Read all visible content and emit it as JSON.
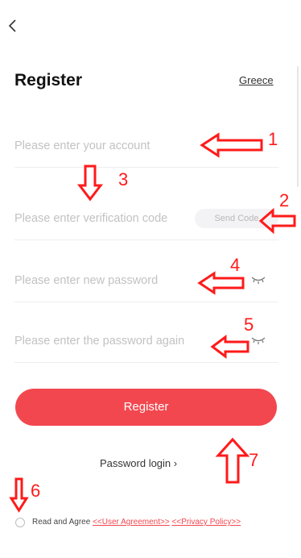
{
  "header": {
    "back_icon": "chevron-left-icon"
  },
  "title": "Register",
  "region": "Greece",
  "fields": {
    "account": {
      "placeholder": "Please enter your account"
    },
    "code": {
      "placeholder": "Please enter verification code",
      "send_code_label": "Send Code"
    },
    "password": {
      "placeholder": "Please enter new password",
      "eye_icon": "eye-closed-icon"
    },
    "password_again": {
      "placeholder": "Please enter the password again",
      "eye_icon": "eye-closed-icon"
    }
  },
  "register_button": "Register",
  "password_login": "Password login ›",
  "agreement": {
    "prefix": "Read and Agree",
    "user_agreement": "<<User Agreement>>",
    "privacy_policy": "<<Privacy Policy>>"
  },
  "annotations": [
    "1",
    "2",
    "3",
    "4",
    "5",
    "6",
    "7"
  ],
  "colors": {
    "accent": "#f2474f",
    "annotation": "#ff1a1a"
  }
}
